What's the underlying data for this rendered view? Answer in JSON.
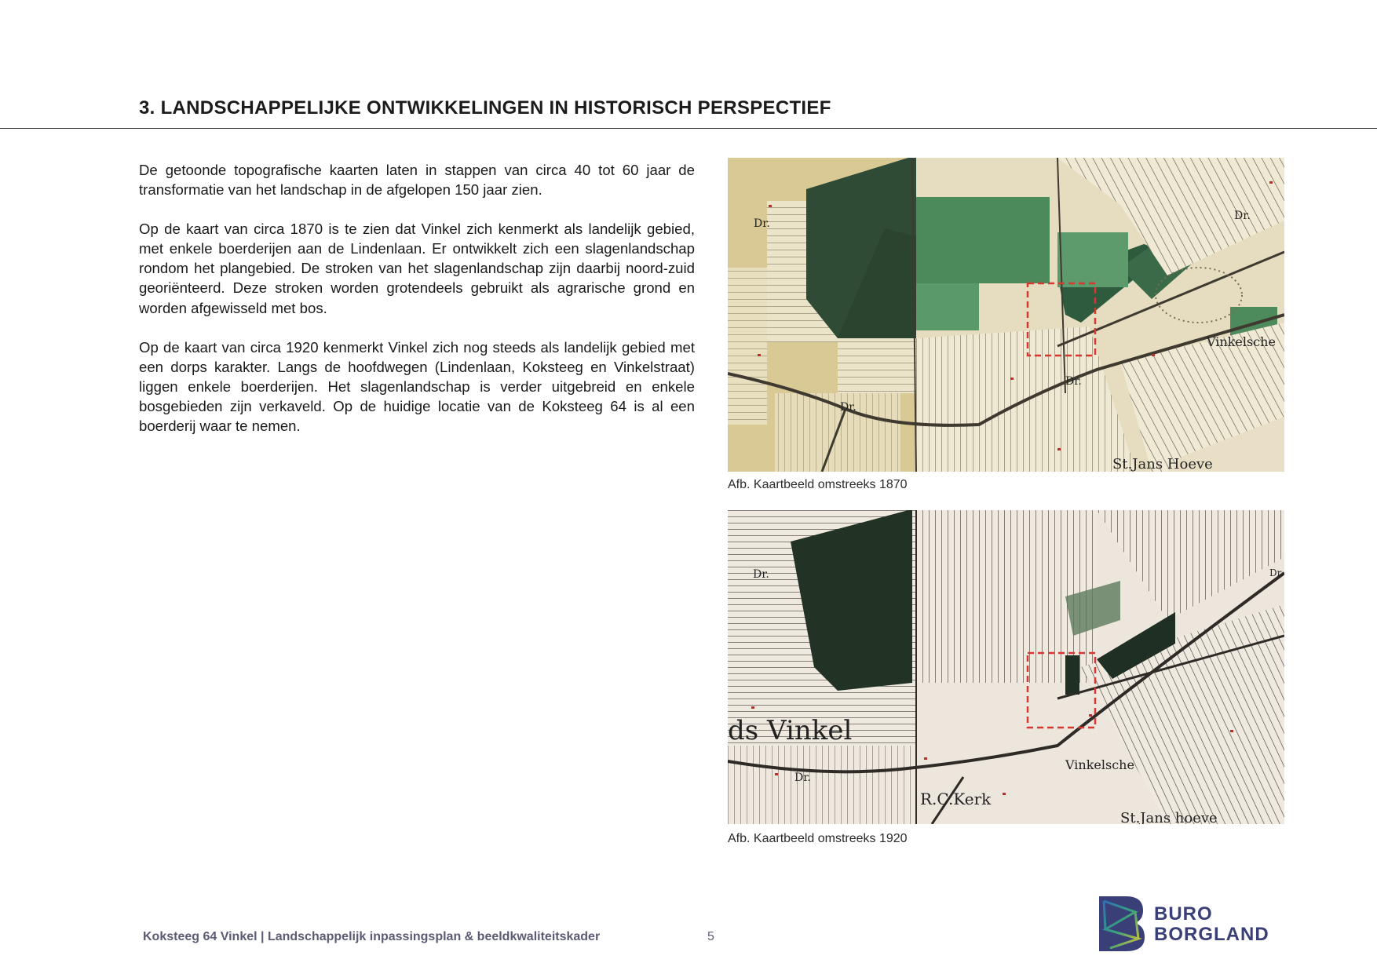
{
  "page": {
    "heading": "3. LANDSCHAPPELIJKE ONTWIKKELINGEN IN HISTORISCH PERSPECTIEF",
    "paragraphs": [
      "De getoonde topografische kaarten laten in stappen van circa 40 tot 60 jaar de transformatie van het landschap in de afgelopen 150 jaar zien.",
      "Op de kaart van circa 1870 is te zien dat Vinkel zich kenmerkt als landelijk gebied, met enkele boerderijen aan de Lindenlaan. Er ontwikkelt zich een slagenlandschap rondom het plangebied. De stroken van het slagenlandschap zijn daarbij noord-zuid georiënteerd. Deze stroken worden grotendeels gebruikt als agrarische grond en worden afgewisseld met bos.",
      "Op de kaart van circa 1920 kenmerkt Vinkel zich nog steeds als landelijk gebied met een dorps karakter. Langs de hoofdwegen (Lindenlaan, Koksteeg en Vinkelstraat) liggen enkele boerderijen. Het slagenlandschap is verder uitgebreid en enkele bosgebieden zijn verkaveld. Op de huidige locatie van de Koksteeg 64 is al een boerderij waar te nemen."
    ]
  },
  "figures": [
    {
      "caption": "Afb. Kaartbeeld omstreeks 1870",
      "map_labels": [
        "Dr.",
        "Dr.",
        "Dr.",
        "Dr.",
        "Vinkelsche",
        "St.Jans Hoeve"
      ]
    },
    {
      "caption": "Afb. Kaartbeeld omstreeks 1920",
      "map_labels": [
        "Dr.",
        "ds Vinkel",
        "Dr.",
        "Vinkelsche",
        "R.C.Kerk",
        "St.Jans hoeve",
        "Dr."
      ]
    }
  ],
  "footer": {
    "doc_title": "Koksteeg 64 Vinkel",
    "separator": " | ",
    "doc_subtitle": "Landschappelijk inpassingsplan & beeldkwaliteitskader",
    "page_number": "5"
  },
  "logo": {
    "line1": "BURO",
    "line2": "BORGLAND"
  },
  "colors": {
    "map_paper_1870": "#e6ddc0",
    "map_forest_1870": "#2f5b3c",
    "map_meadow_1870": "#4f8a5e",
    "map_paper_1920": "#ece6dc",
    "map_forest_1920": "#233427",
    "marker_red": "#d6382f",
    "footer_text": "#5b5b75",
    "logo_navy": "#3a3f78"
  }
}
